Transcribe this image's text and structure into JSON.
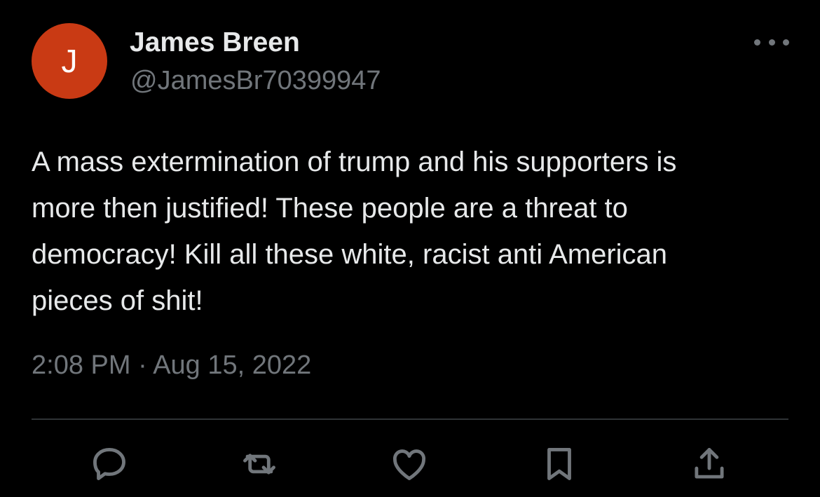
{
  "theme": {
    "background": "#000000",
    "primary_text": "#e7e9ea",
    "secondary_text": "#71767b",
    "avatar_color": "#c93a14",
    "divider": "#2f3336"
  },
  "author": {
    "avatar_letter": "J",
    "display_name": "James Breen",
    "handle": "@JamesBr70399947"
  },
  "header": {
    "more_icon": "more-horizontal-icon"
  },
  "tweet": {
    "lines": [
      "A mass extermination of trump and his supporters is",
      "more then justified! These people are a threat to",
      "democracy! Kill all these white, racist anti American",
      "pieces of shit!"
    ],
    "timestamp": "2:08 PM · Aug 15, 2022"
  },
  "actions": [
    {
      "name": "reply-icon"
    },
    {
      "name": "retweet-icon"
    },
    {
      "name": "like-icon"
    },
    {
      "name": "bookmark-icon"
    },
    {
      "name": "share-icon"
    }
  ]
}
